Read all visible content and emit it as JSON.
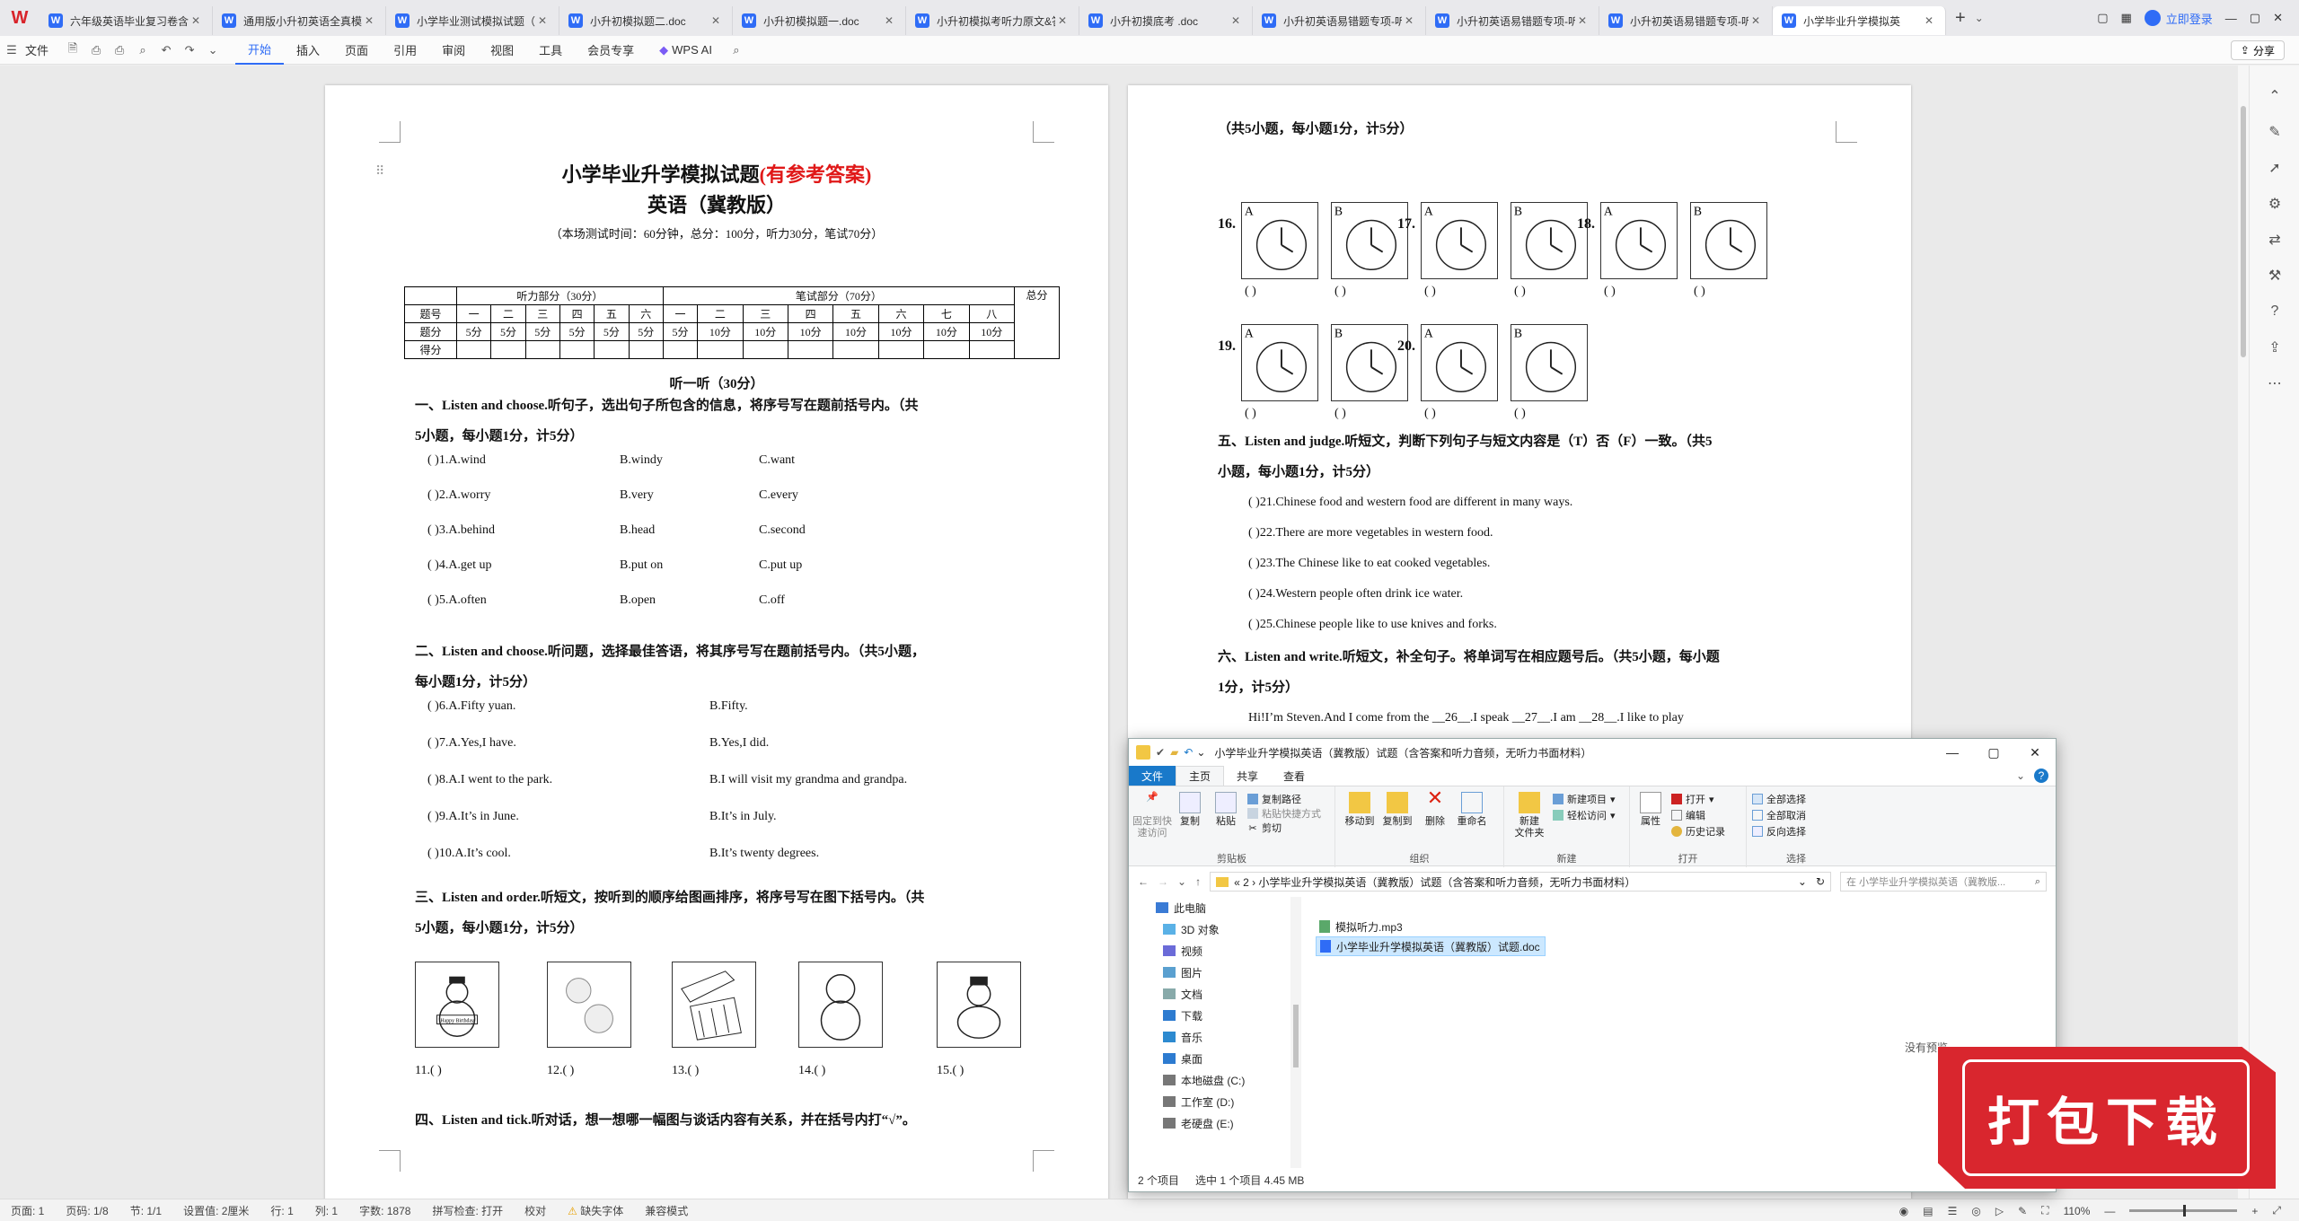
{
  "tabs": [
    {
      "label": "六年级英语毕业复习卷含听力"
    },
    {
      "label": "通用版小升初英语全真模拟卷"
    },
    {
      "label": "小学毕业测试模拟试题（一）"
    },
    {
      "label": "小升初模拟题二.doc"
    },
    {
      "label": "小升初模拟题一.doc"
    },
    {
      "label": "小升初模拟考听力原文&答案"
    },
    {
      "label": "小升初摸底考 .doc"
    },
    {
      "label": "小升初英语易错题专项-听力"
    },
    {
      "label": "小升初英语易错题专项-听力"
    },
    {
      "label": "小升初英语易错题专项-听力"
    },
    {
      "label": "小学毕业升学模拟英"
    }
  ],
  "topbar": {
    "login": "立即登录"
  },
  "ribbon": {
    "file": "文件",
    "items": [
      "开始",
      "插入",
      "页面",
      "引用",
      "审阅",
      "视图",
      "工具",
      "会员专享"
    ],
    "wpsai": "WPS AI",
    "share": "分享"
  },
  "page1": {
    "title": "小学毕业升学模拟试题",
    "title_red": "(有参考答案)",
    "subtitle": "英语（冀教版）",
    "note": "（本场测试时间：60分钟，总分：100分，听力30分，笔试70分）",
    "table": {
      "listen": "听力部分（30分）",
      "written": "笔试部分（70分）",
      "total": "总分",
      "row1": [
        "题号",
        "一",
        "二",
        "三",
        "四",
        "五",
        "六",
        "一",
        "二",
        "三",
        "四",
        "五",
        "六",
        "七",
        "八"
      ],
      "row2": [
        "题分",
        "5分",
        "5分",
        "5分",
        "5分",
        "5分",
        "5分",
        "5分",
        "10分",
        "10分",
        "10分",
        "10分",
        "10分",
        "10分",
        "10分"
      ],
      "row3": "得分"
    },
    "listen_head": "听一听（30分）",
    "s1_head": "一、Listen and choose.听句子，选出句子所包含的信息，将序号写在题前括号内。（共",
    "s1_head2": "5小题，每小题1分，计5分）",
    "s1": [
      {
        "n": "(        )1.A.wind",
        "b": "B.windy",
        "c": "C.want"
      },
      {
        "n": "(        )2.A.worry",
        "b": "B.very",
        "c": "C.every"
      },
      {
        "n": "(        )3.A.behind",
        "b": "B.head",
        "c": "C.second"
      },
      {
        "n": "(        )4.A.get up",
        "b": "B.put on",
        "c": "C.put up"
      },
      {
        "n": "(        )5.A.often",
        "b": "B.open",
        "c": "C.off"
      }
    ],
    "s2_head": "二、Listen and choose.听问题，选择最佳答语，将其序号写在题前括号内。（共5小题，",
    "s2_head2": "每小题1分，计5分）",
    "s2": [
      {
        "a": "(        )6.A.Fifty yuan.",
        "b": "B.Fifty."
      },
      {
        "a": "(        )7.A.Yes,I have.",
        "b": "B.Yes,I did."
      },
      {
        "a": "(        )8.A.I went to the park.",
        "b": "B.I will visit my grandma and grandpa."
      },
      {
        "a": "(        )9.A.It’s in June.",
        "b": "B.It’s in July."
      },
      {
        "a": "(        )10.A.It’s cool.",
        "b": "B.It’s twenty degrees."
      }
    ],
    "s3_head": "三、Listen and order.听短文，按听到的顺序给图画排序，将序号写在图下括号内。（共",
    "s3_head2": "5小题，每小题1分，计5分）",
    "s3_labels": [
      "11.(        )",
      "12.(        )",
      "13.(        )",
      "14.(        )",
      "15.(        )"
    ],
    "s4_head": "四、Listen and tick.听对话，想一想哪一幅图与谈话内容有关系，并在括号内打“√”。"
  },
  "page2": {
    "top": "（共5小题，每小题1分，计5分）",
    "q_nums": [
      "16.",
      "17.",
      "18.",
      "19.",
      "20."
    ],
    "paren": "(        )",
    "s5_head": "五、Listen and judge.听短文，判断下列句子与短文内容是（T）否（F）一致。（共5",
    "s5_head2": "小题，每小题1分，计5分）",
    "s5": [
      "(        )21.Chinese food and western food are different in many ways.",
      "(        )22.There are more vegetables in western food.",
      "(        )23.The Chinese like to eat cooked vegetables.",
      "(        )24.Western people often drink ice water.",
      "(        )25.Chinese people like to use knives and forks."
    ],
    "s6_head": "六、Listen and write.听短文，补全句子。将单词写在相应题号后。（共5小题，每小题",
    "s6_head2": "1分，计5分）",
    "s6_line": "Hi!I’m Steven.And I come from the __26__.I speak __27__.I am __28__.I like to play"
  },
  "explorer": {
    "title": "小学毕业升学模拟英语（冀教版）试题（含答案和听力音频，无听力书面材料）",
    "tabs": [
      "文件",
      "主页",
      "共享",
      "查看"
    ],
    "groups": {
      "clipboard": "剪贴板",
      "organize": "组织",
      "new": "新建",
      "open": "打开",
      "select": "选择"
    },
    "buttons": {
      "pin": "固定到快\n速访问",
      "copy": "复制",
      "paste": "粘贴",
      "copy_path": "复制路径",
      "paste_shortcut": "粘贴快捷方式",
      "cut": "剪切",
      "move_to": "移动到",
      "copy_to": "复制到",
      "delete": "删除",
      "rename": "重命名",
      "new_folder": "新建\n文件夹",
      "new_item": "新建项目",
      "easy_access": "轻松访问",
      "properties": "属性",
      "open": "打开",
      "edit": "编辑",
      "history": "历史记录",
      "select_all": "全部选择",
      "select_none": "全部取消",
      "invert": "反向选择"
    },
    "path": "«  2  ›  小学毕业升学模拟英语（冀教版）试题（含答案和听力音频，无听力书面材料）",
    "search_placeholder": "在 小学毕业升学模拟英语（冀教版...",
    "nav": [
      {
        "label": "此电脑"
      },
      {
        "label": "3D 对象"
      },
      {
        "label": "视频"
      },
      {
        "label": "图片"
      },
      {
        "label": "文档"
      },
      {
        "label": "下载"
      },
      {
        "label": "音乐"
      },
      {
        "label": "桌面"
      },
      {
        "label": "本地磁盘 (C:)"
      },
      {
        "label": "工作室 (D:)"
      },
      {
        "label": "老硬盘 (E:)"
      }
    ],
    "files": [
      {
        "name": "模拟听力.mp3"
      },
      {
        "name": "小学毕业升学模拟英语（冀教版）试题.doc"
      }
    ],
    "preview": "没有预览。",
    "status_count": "2 个项目",
    "status_sel": "选中 1 个项目  4.45 MB"
  },
  "statusbar": {
    "page": "页面: 1",
    "pages": "页码: 1/8",
    "section": "节: 1/1",
    "setting": "设置值: 2厘米",
    "row": "行: 1",
    "col": "列: 1",
    "words": "字数: 1878",
    "spell": "拼写检查: 打开",
    "proof": "校对",
    "font": "缺失字体",
    "compat": "兼容模式",
    "zoom": "110%"
  },
  "download_banner": "打包下载"
}
